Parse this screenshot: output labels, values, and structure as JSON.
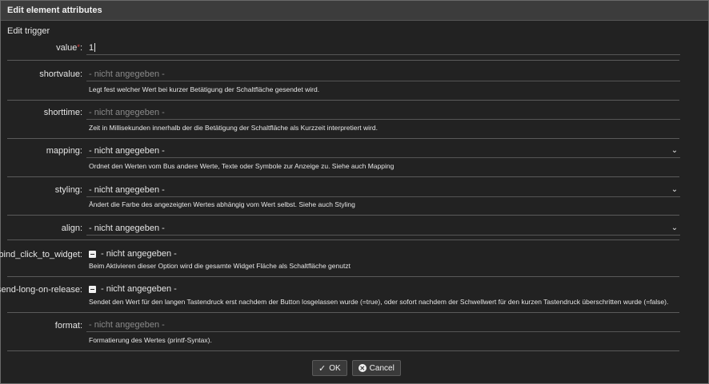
{
  "dialog": {
    "title": "Edit element attributes",
    "subtitle": "Edit trigger"
  },
  "fields": {
    "value": {
      "label": "value",
      "required_mark": "*",
      "colon": ":",
      "value": "1"
    },
    "shortvalue": {
      "label": "shortvalue:",
      "placeholder": "- nicht angegeben -",
      "description": "Legt fest welcher Wert bei kurzer Betätigung der Schaltfläche gesendet wird."
    },
    "shorttime": {
      "label": "shorttime:",
      "placeholder": "- nicht angegeben -",
      "description": "Zeit in Millisekunden innerhalb der die Betätigung der Schaltfläche als Kurzzeit interpretiert wird."
    },
    "mapping": {
      "label": "mapping:",
      "selected": "- nicht angegeben -",
      "description": "Ordnet den Werten vom Bus andere Werte, Texte oder Symbole zur Anzeige zu. Siehe auch Mapping"
    },
    "styling": {
      "label": "styling:",
      "selected": "- nicht angegeben -",
      "description": "Ändert die Farbe des angezeigten Wertes abhängig vom Wert selbst. Siehe auch Styling"
    },
    "align": {
      "label": "align:",
      "selected": "- nicht angegeben -"
    },
    "bind_click_to_widget": {
      "label": "bind_click_to_widget:",
      "state": "- nicht angegeben -",
      "description": "Beim Aktivieren dieser Option wird die gesamte Widget Fläche als Schaltfläche genutzt"
    },
    "send_long_on_release": {
      "label": "send-long-on-release:",
      "state": "- nicht angegeben -",
      "description": "Sendet den Wert für den langen Tastendruck erst nachdem der Button losgelassen wurde (=true), oder sofort nachdem der Schwellwert für den kurzen Tastendruck überschritten wurde (=false)."
    },
    "format": {
      "label": "format:",
      "placeholder": "- nicht angegeben -",
      "description": "Formatierung des Wertes (printf-Syntax)."
    }
  },
  "buttons": {
    "ok": "OK",
    "cancel": "Cancel"
  },
  "icons": {
    "select": "chevron-down-icon",
    "checkbox": "checkbox-indeterminate-icon",
    "ok": "checkmark-icon",
    "cancel": "cancel-circle-icon"
  },
  "colors": {
    "background": "#222222",
    "titlebar": "#3c3c3c",
    "required": "#e04040"
  }
}
